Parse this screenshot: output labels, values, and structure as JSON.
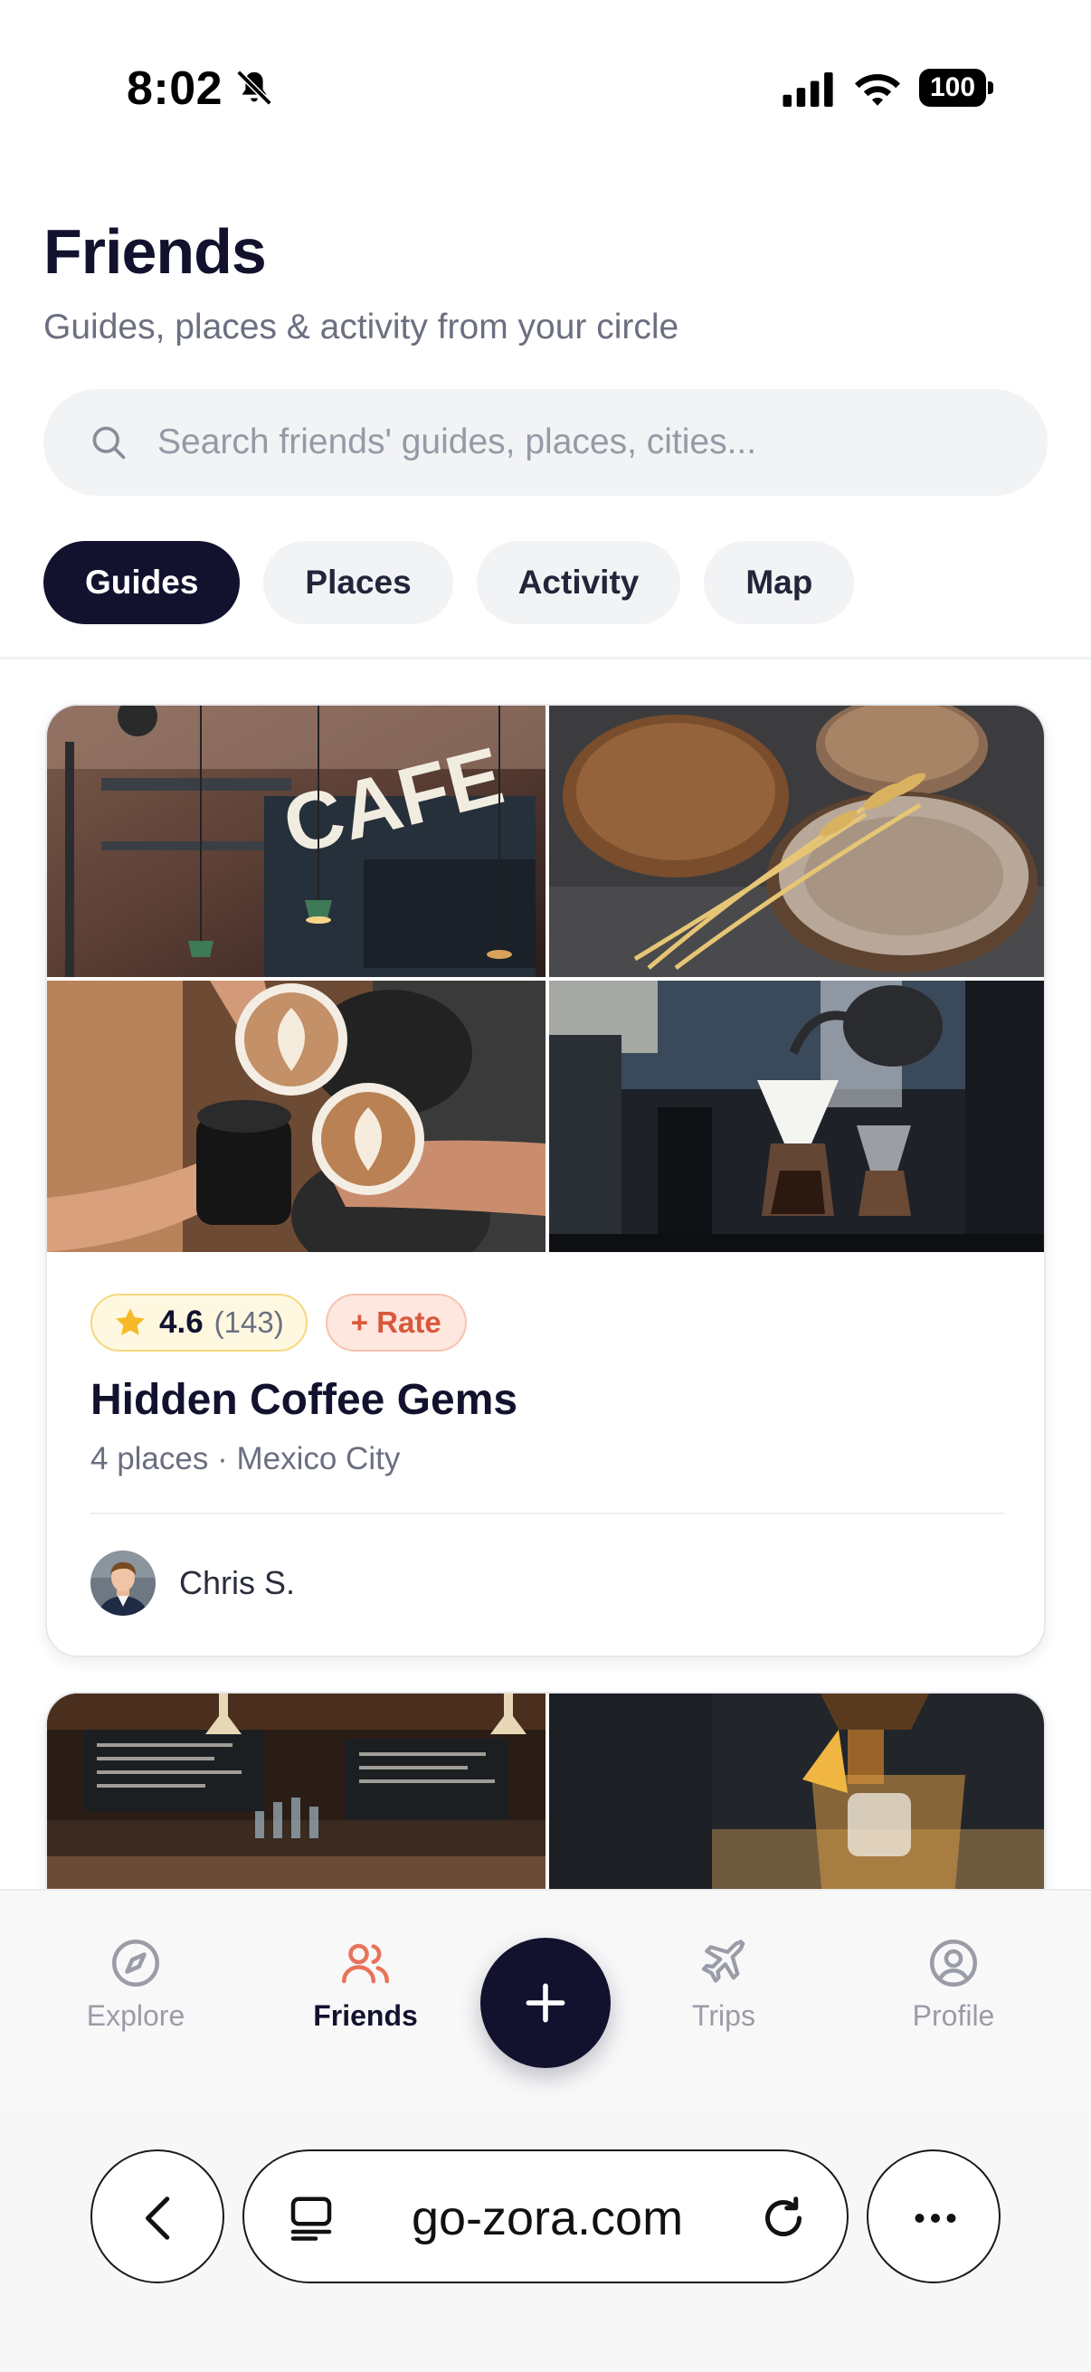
{
  "status_bar": {
    "time": "8:02",
    "battery": "100",
    "icons": [
      "bell-slash-icon",
      "signal-icon",
      "wifi-icon",
      "battery-icon"
    ]
  },
  "header": {
    "title": "Friends",
    "subtitle": "Guides, places & activity from your circle"
  },
  "search": {
    "placeholder": "Search friends' guides, places, cities...",
    "value": ""
  },
  "tabs": [
    {
      "label": "Guides",
      "active": true
    },
    {
      "label": "Places",
      "active": false
    },
    {
      "label": "Activity",
      "active": false
    },
    {
      "label": "Map",
      "active": false
    }
  ],
  "guides": [
    {
      "rating": "4.6",
      "rating_count": "(143)",
      "rate_label": "+ Rate",
      "title": "Hidden Coffee Gems",
      "meta": "4 places · Mexico City",
      "author": "Chris S.",
      "photos": [
        "cafe-sign-photo",
        "bread-loaves-photo",
        "latte-cheers-photo",
        "pour-over-coffee-photo"
      ]
    },
    {
      "photos": [
        "bar-interior-photo",
        "cocktail-pour-photo"
      ]
    }
  ],
  "bottom_nav": {
    "items": [
      {
        "label": "Explore",
        "icon": "compass-icon",
        "active": false
      },
      {
        "label": "Friends",
        "icon": "users-icon",
        "active": true
      },
      {
        "label": "Trips",
        "icon": "plane-icon",
        "active": false
      },
      {
        "label": "Profile",
        "icon": "user-circle-icon",
        "active": false
      }
    ],
    "add_icon": "plus-icon"
  },
  "browser": {
    "url": "go-zora.com"
  },
  "colors": {
    "brand_dark": "#12122e",
    "accent_coral": "#e8735a",
    "rating_yellow": "#f7b928"
  }
}
